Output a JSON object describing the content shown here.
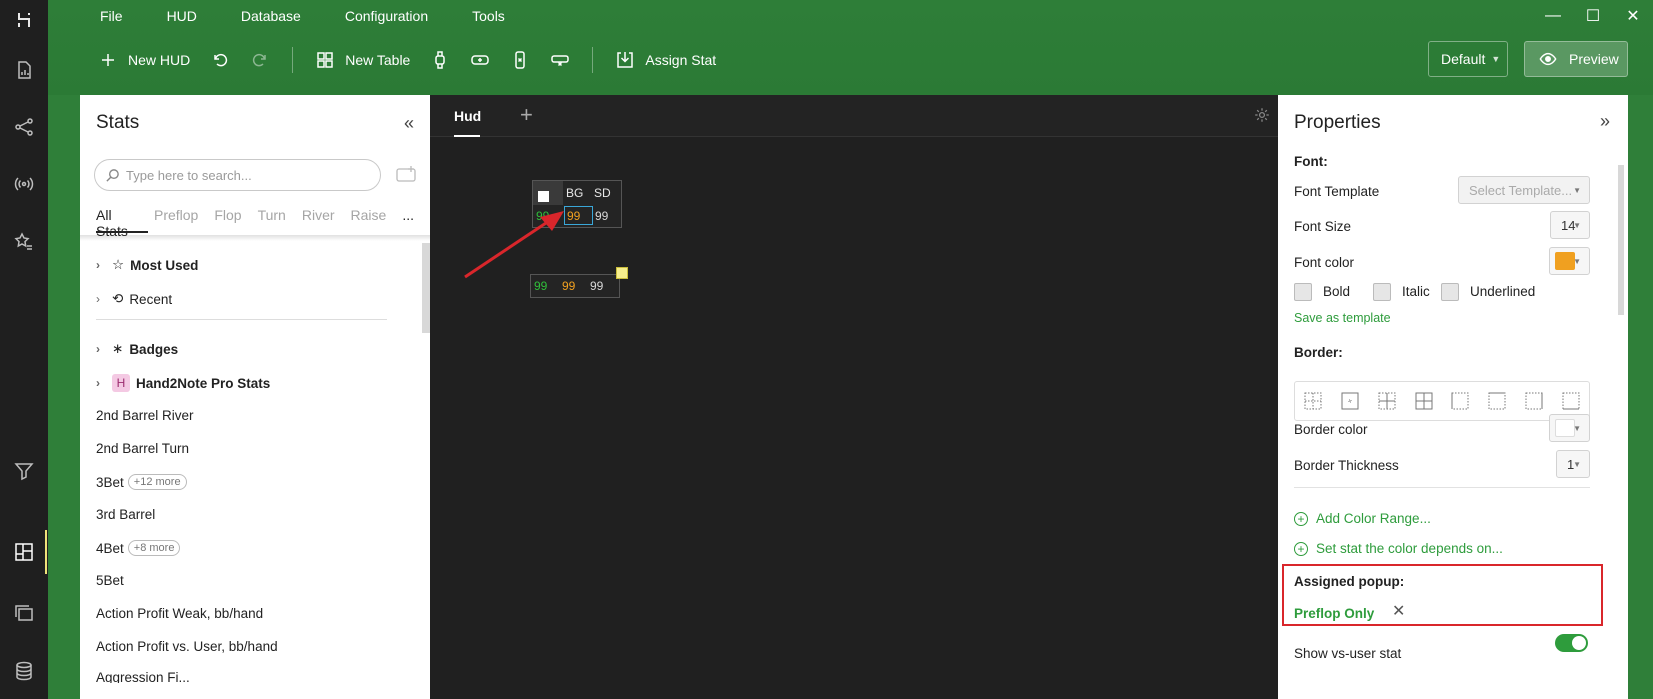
{
  "menu": [
    "File",
    "HUD",
    "Database",
    "Configuration",
    "Tools"
  ],
  "toolbar": {
    "new_hud": "New HUD",
    "new_table": "New Table",
    "assign_stat": "Assign Stat",
    "profile": "Default",
    "preview": "Preview"
  },
  "stats_panel": {
    "title": "Stats",
    "search_placeholder": "Type here to search...",
    "tabs": [
      "All Stats",
      "Preflop",
      "Flop",
      "Turn",
      "River",
      "Raise",
      "..."
    ],
    "groups": [
      {
        "label": "Most Used",
        "icon": "☆"
      },
      {
        "label": "Recent",
        "icon": "⟲"
      },
      {
        "label": "Badges",
        "icon": "∗"
      },
      {
        "label": "Hand2Note Pro Stats",
        "icon": "H"
      }
    ],
    "items": [
      {
        "label": "2nd Barrel River",
        "more": ""
      },
      {
        "label": "2nd Barrel Turn",
        "more": ""
      },
      {
        "label": "3Bet",
        "more": "+12 more"
      },
      {
        "label": "3rd Barrel",
        "more": ""
      },
      {
        "label": "4Bet",
        "more": "+8 more"
      },
      {
        "label": "5Bet",
        "more": ""
      },
      {
        "label": "Action Profit Weak, bb/hand",
        "more": ""
      },
      {
        "label": "Action Profit vs. User, bb/hand",
        "more": ""
      },
      {
        "label": "Aggression Fi...",
        "more": ""
      }
    ]
  },
  "canvas": {
    "tab": "Hud",
    "hud1": {
      "headers": [
        "BG",
        "SD"
      ],
      "values": [
        "99",
        "99",
        "99"
      ]
    },
    "hud2": {
      "values": [
        "99",
        "99",
        "99"
      ]
    },
    "colors": {
      "green": "#2fbf3a",
      "orange": "#f0a020",
      "white": "#d8d8d8"
    }
  },
  "properties": {
    "title": "Properties",
    "font_header": "Font:",
    "font_template_label": "Font Template",
    "font_template_value": "Select Template...",
    "font_size_label": "Font Size",
    "font_size_value": "14",
    "font_color_label": "Font color",
    "font_color_hex": "#f0a020",
    "bold": "Bold",
    "italic": "Italic",
    "underlined": "Underlined",
    "save_template": "Save as template",
    "border_header": "Border:",
    "border_color_label": "Border color",
    "border_thickness_label": "Border Thickness",
    "border_thickness_value": "1",
    "add_color_range": "Add Color Range...",
    "set_stat_color": "Set stat the color depends on...",
    "assigned_popup_label": "Assigned popup:",
    "assigned_popup_value": "Preflop Only",
    "show_vs_user": "Show vs-user stat",
    "show_vs_user_on": true
  }
}
